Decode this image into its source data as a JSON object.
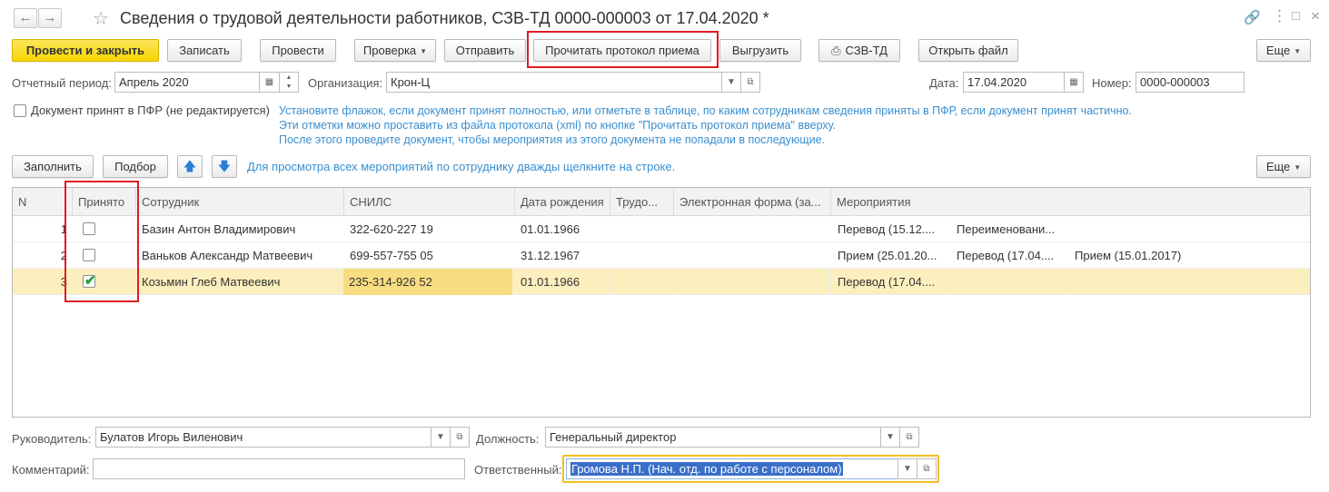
{
  "window": {
    "title": "Сведения о трудовой деятельности работников, СЗВ-ТД 0000-000003 от 17.04.2020 *",
    "back_icon": "arrow-left-icon",
    "forward_icon": "arrow-right-icon",
    "favorite_icon": "star-icon",
    "link_icon": "link-icon",
    "menu_icon": "more-vertical-icon",
    "maximize_icon": "maximize-icon",
    "close_icon": "close-icon"
  },
  "toolbar": {
    "post_and_close": "Провести и закрыть",
    "save": "Записать",
    "post": "Провести",
    "check": "Проверка",
    "send": "Отправить",
    "read_protocol": "Прочитать протокол приема",
    "export": "Выгрузить",
    "print_szv": "СЗВ-ТД",
    "open_file": "Открыть файл",
    "more": "Еще"
  },
  "header": {
    "period_label": "Отчетный период:",
    "period_value": "Апрель 2020",
    "org_label": "Организация:",
    "org_value": "Крон-Ц",
    "date_label": "Дата:",
    "date_value": "17.04.2020",
    "number_label": "Номер:",
    "number_value": "0000-000003"
  },
  "accepted_checkbox": {
    "label": "Документ принят в ПФР (не редактируется)",
    "checked": false
  },
  "hints": [
    "Установите флажок, если документ принят полностью, или отметьте в таблице, по каким сотрудникам сведения приняты в ПФР, если документ принят частично.",
    "Эти отметки можно проставить из файла протокола (xml) по кнопке \"Прочитать протокол приема\" вверху.",
    "После этого проведите документ, чтобы мероприятия из этого документа не попадали в последующие."
  ],
  "table_toolbar": {
    "fill": "Заполнить",
    "select": "Подбор",
    "move_up_icon": "arrow-up-icon",
    "move_down_icon": "arrow-down-icon",
    "hint": "Для просмотра всех мероприятий по сотруднику дважды щелкните на строке.",
    "more": "Еще"
  },
  "table": {
    "columns": [
      "N",
      "Принято",
      "Сотрудник",
      "СНИЛС",
      "Дата рождения",
      "Трудо...",
      "Электронная форма (за...",
      "Мероприятия"
    ],
    "rows": [
      {
        "n": "1",
        "accepted": false,
        "employee": "Базин Антон Владимирович",
        "snils": "322-620-227 19",
        "birth": "01.01.1966",
        "events": [
          "Перевод (15.12....",
          "Переименовани...",
          ""
        ]
      },
      {
        "n": "2",
        "accepted": false,
        "employee": "Ваньков Александр Матвеевич",
        "snils": "699-557-755 05",
        "birth": "31.12.1967",
        "events": [
          "Прием (25.01.20...",
          "Перевод (17.04....",
          "Прием (15.01.2017)"
        ]
      },
      {
        "n": "3",
        "accepted": true,
        "employee": "Козьмин Глеб Матвеевич",
        "snils": "235-314-926 52",
        "birth": "01.01.1966",
        "events": [
          "Перевод (17.04....",
          "",
          ""
        ]
      }
    ]
  },
  "footer": {
    "head_label": "Руководитель:",
    "head_value": "Булатов Игорь Виленович",
    "position_label": "Должность:",
    "position_value": "Генеральный директор",
    "comment_label": "Комментарий:",
    "comment_value": "",
    "responsible_label": "Ответственный:",
    "responsible_value": "Громова Н.П. (Нач. отд. по работе с персоналом)"
  },
  "colors": {
    "primary_button": "#f5d500",
    "hint_text": "#3a8fd0",
    "selected_row": "#fcefbe",
    "highlight_box": "#e01b24",
    "checkmark": "#1e9e3a"
  }
}
